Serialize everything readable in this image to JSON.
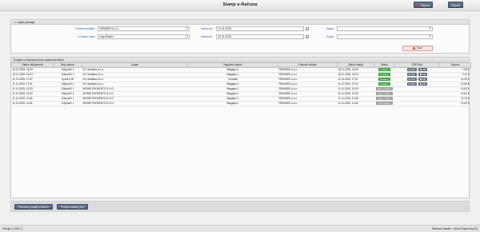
{
  "window": {
    "title": "Stanje e-Računa",
    "close_label": "Odjava",
    "logout_label": "Odvezi"
  },
  "filter_panel": {
    "header": "Uvjeti pretrage",
    "fields": {
      "partner_label": "Poslovni subjekt:",
      "partner_value": "REMARIS d.o.o.",
      "eracun_label": "e-Račun vrsta:",
      "eracun_value": "Izaj-eRačun",
      "date_from_label": "Datum od :",
      "date_from_value": "01.11.2025.",
      "date_to_label": "Datum do :",
      "date_to_value": "30.11.2025.",
      "status_label": "Status:",
      "status_value": "",
      "kupac_label": "Kupac:",
      "kupac_value": ""
    },
    "search_label": "Traži"
  },
  "results": {
    "header": "Pregled e-Računa prema zadanima filteru",
    "columns": [
      "Datum dokumenta",
      "Broj računa",
      "Kupac",
      "Naplatno mjesto",
      "Poslovni subjekt",
      "Datum slanja",
      "Status",
      "PDF/XML",
      "Ukupno"
    ],
    "pdf_label": "PDF",
    "zip_label": "ZIP",
    "rows": [
      {
        "date": "18.11.2025. 16:29",
        "number": "14/lposl2/ 1",
        "customer": "A1 Hrvatska d.o.o.",
        "place": "Blagajna 1",
        "subject": "REMARIS d.o.o.",
        "sent": "18.11.2025. 16:29",
        "status": "Poslano",
        "status_type": "ok",
        "has_files": true,
        "total": "7,96 €"
      },
      {
        "date": "18.11.2025. 16:22",
        "number": "14/lposl2/ 1",
        "customer": "A1 Hrvatska d.o.o.",
        "place": "Blagajna 1",
        "subject": "REMARIS d.o.o.",
        "sent": "18.11.2025. 16:22",
        "status": "Poslano",
        "status_type": "ok",
        "has_files": true,
        "total": "2,12 €"
      },
      {
        "date": "11.11.2025. 17:57",
        "number": "1/posl1/ 90",
        "customer": "A1 Hrvatska d.o.o.",
        "place": "Centrala",
        "subject": "REMARIS d.o.o.",
        "sent": "11.11.2025. 17:57",
        "status": "Poslano",
        "status_type": "ok",
        "has_files": true,
        "total": "11,94 €"
      },
      {
        "date": "11.11.2025. 17:51",
        "number": "14/lposl2/ 1",
        "customer": "A1 Hrvatska d.o.o.",
        "place": "Blagajna 1",
        "subject": "REMARIS d.o.o.",
        "sent": "11.11.2025. 17:51",
        "status": "Poslano",
        "status_type": "ok",
        "has_files": true,
        "total": "13,60 €"
      },
      {
        "date": "11.11.2025. 13:33",
        "number": "13/lposl2/ 1",
        "customer": "MONRI PAYMENTS D.O.O.",
        "place": "Blagajna 1",
        "subject": "REMARIS d.o.o.",
        "sent": "11.11.2025. 13:33",
        "status": "Nije poslano",
        "status_type": "nr",
        "has_files": false,
        "total": "10,62 €"
      },
      {
        "date": "11.11.2025. 12:00",
        "number": "13/lposl2/ 1",
        "customer": "MONRI PAYMENTS D.O.O.",
        "place": "Blagajna 1",
        "subject": "REMARIS d.o.o.",
        "sent": "11.11.2025. 12:00",
        "status": "Nije poslano",
        "status_type": "nr",
        "has_files": false,
        "total": "13,60 €"
      },
      {
        "date": "11.11.2025. 11:56",
        "number": "12/lposl2/ 1",
        "customer": "MONRI PAYMENTS D.O.O.",
        "place": "Blagajna 1",
        "subject": "REMARIS d.o.o.",
        "sent": "11.11.2025. 11:56",
        "status": "Nije poslano",
        "status_type": "nr",
        "has_files": false,
        "total": "11,13 €"
      },
      {
        "date": "11.11.2025. 11:54",
        "number": "11/lposl2/ 1",
        "customer": "MONRI PAYMENTS D.O.O.",
        "place": "Blagajna 1",
        "subject": "REMARIS d.o.o.",
        "sent": "11.11.2025. 11:54",
        "status": "Nije poslano",
        "status_type": "nr",
        "has_files": false,
        "total": "10,62 €"
      }
    ]
  },
  "bottom": {
    "resend_label": "Ponovno pošalji e-Račun",
    "check_label": "Provjeri status (1/x)"
  },
  "statusbar": {
    "version": "Verzija 2.105.1.1",
    "user": "Remaris Master - Monri Payments (K)"
  },
  "colors": {
    "accent": "#4b5b74",
    "ok": "#35a13a",
    "not_sent": "#9a9a9a",
    "label": "#2a62b5"
  }
}
